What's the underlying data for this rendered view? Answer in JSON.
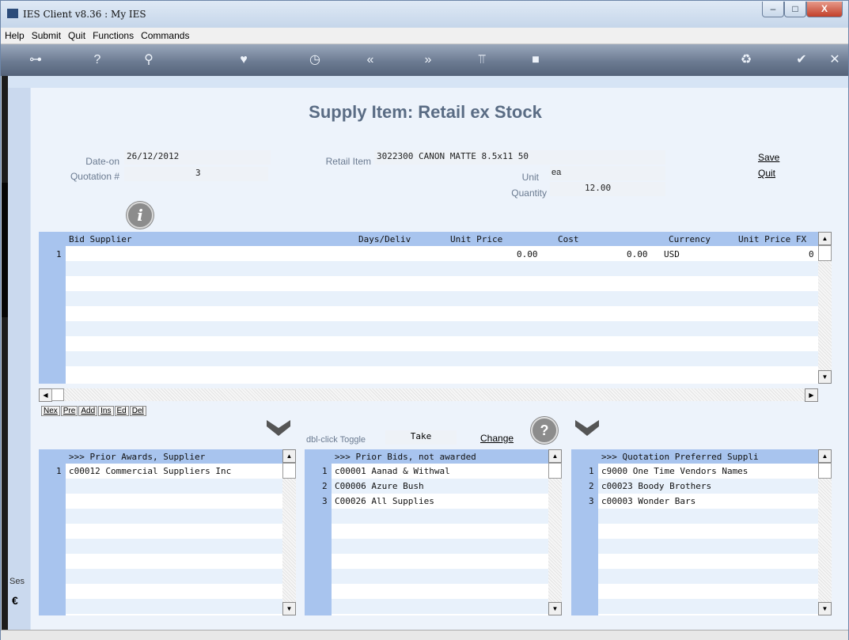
{
  "window": {
    "title": "IES Client v8.36 : My IES",
    "min": "–",
    "max": "□",
    "close": "X"
  },
  "menu": [
    "Help",
    "Submit",
    "Quit",
    "Functions",
    "Commands"
  ],
  "toolbar": {
    "icons": [
      "key-icon",
      "help-icon",
      "search-icon",
      "heart-icon",
      "clock-icon",
      "rewind-icon",
      "fast-forward-icon",
      "tools-icon",
      "stop-icon",
      "recycle-icon",
      "check-icon",
      "close-icon"
    ]
  },
  "page": {
    "title": "Supply Item: Retail ex Stock"
  },
  "form": {
    "date_on_label": "Date-on",
    "date_on": "26/12/2012",
    "quotation_label": "Quotation #",
    "quotation": "3",
    "retail_item_label": "Retail Item",
    "retail_item": "3022300 CANON MATTE 8.5x11 50",
    "unit_label": "Unit",
    "unit": "ea",
    "quantity_label": "Quantity",
    "quantity": "12.00",
    "save": "Save",
    "quit": "Quit"
  },
  "bid_grid": {
    "headers": [
      "Bid Supplier",
      "Days/Deliv",
      "Unit Price",
      "Cost",
      "Currency",
      "Unit Price FX"
    ],
    "rows": [
      {
        "num": "1",
        "supplier": "",
        "days": "",
        "unit_price": "0.00",
        "cost": "0.00",
        "currency": "USD",
        "fx": "0"
      }
    ]
  },
  "nav": [
    "Nex",
    "Pre",
    "Add",
    "Ins",
    "Ed",
    "Del"
  ],
  "mid_controls": {
    "toggle_label": "dbl-click Toggle",
    "take": "Take",
    "change": "Change"
  },
  "awards": {
    "header": ">>> Prior Awards, Supplier",
    "rows": [
      {
        "num": "1",
        "text": "c00012 Commercial Suppliers Inc"
      }
    ]
  },
  "prior_bids": {
    "header": ">>> Prior Bids, not awarded",
    "rows": [
      {
        "num": "1",
        "text": "c00001 Aanad & Withwal"
      },
      {
        "num": "2",
        "text": "C00006 Azure Bush"
      },
      {
        "num": "3",
        "text": "C00026 All Supplies"
      }
    ]
  },
  "preferred": {
    "header": ">>> Quotation Preferred Suppli",
    "rows": [
      {
        "num": "1",
        "text": "c9000 One Time Vendors Names"
      },
      {
        "num": "2",
        "text": "c00023 Boody Brothers"
      },
      {
        "num": "3",
        "text": "c00003 Wonder Bars"
      }
    ]
  },
  "side": {
    "ses": "Ses"
  }
}
